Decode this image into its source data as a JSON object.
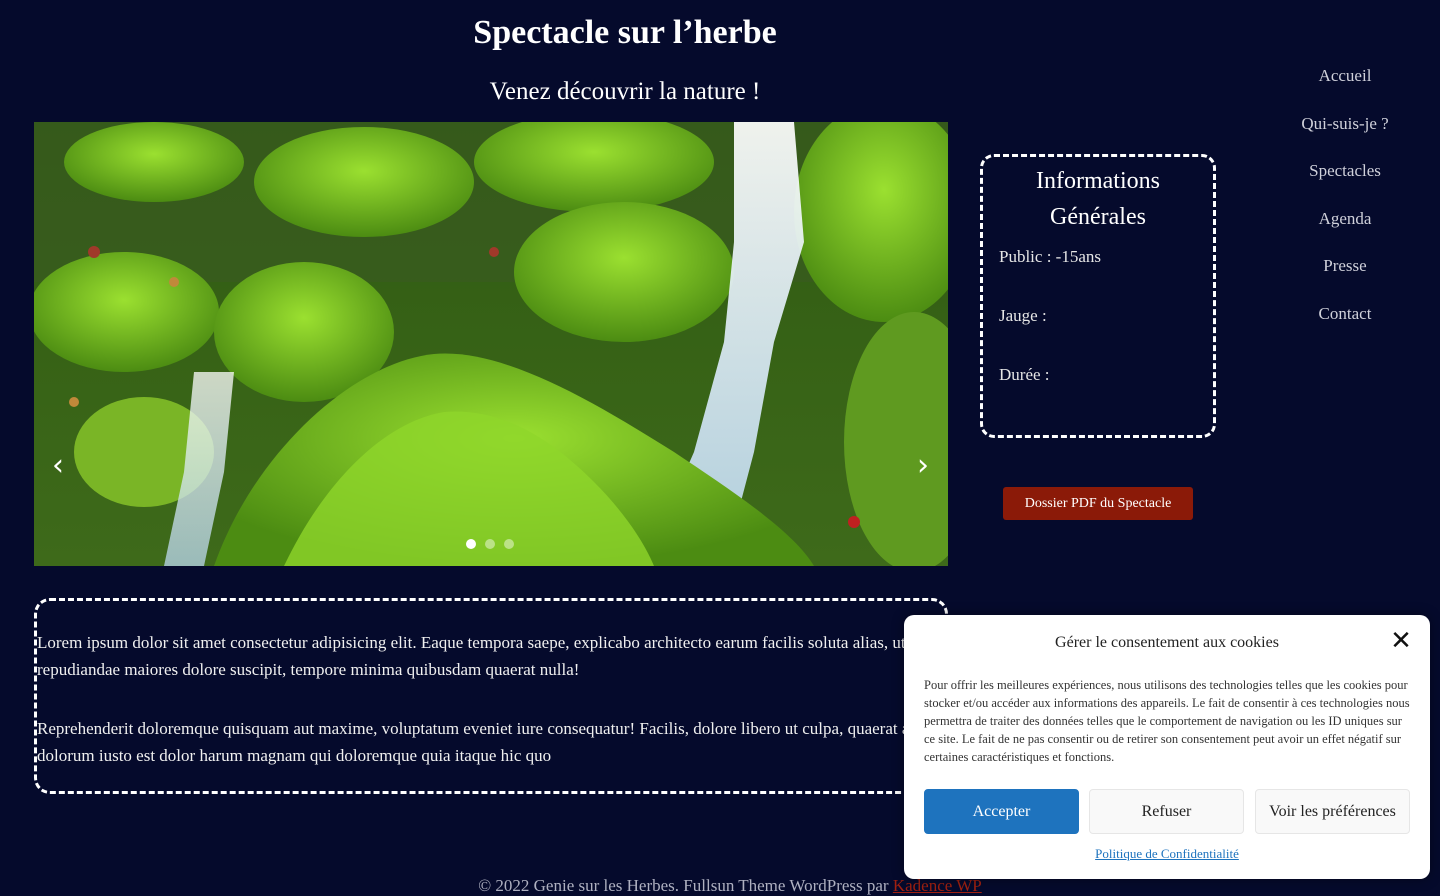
{
  "header": {
    "title": "Spectacle sur l’herbe",
    "subtitle": "Venez découvrir la nature !"
  },
  "nav": {
    "items": [
      "Accueil",
      "Qui-suis-je ?",
      "Spectacles",
      "Agenda",
      "Presse",
      "Contact"
    ]
  },
  "slider": {
    "prev_icon": "chevron-left-icon",
    "next_icon": "chevron-right-icon",
    "prev_glyph": "‹",
    "next_glyph": "›",
    "slide_count": 3,
    "active_slide": 1
  },
  "info": {
    "title": "Informations Générales",
    "public": "Public : -15ans",
    "jauge": "Jauge :",
    "duree": "Durée :"
  },
  "pdf_button": "Dossier PDF du Spectacle",
  "body_text": {
    "p1": "Lorem ipsum dolor sit amet consectetur adipisicing elit. Eaque tempora saepe, explicabo architecto earum facilis soluta alias, ut omnis est repudiandae maiores dolore suscipit, tempore minima quibusdam quaerat nulla!",
    "p2": "Reprehenderit doloremque quisquam aut maxime, voluptatum eveniet iure consequatur! Facilis, dolore libero ut culpa, quaerat asperiores expedita dolorum iusto est dolor harum magnam qui doloremque quia itaque hic quo"
  },
  "footer": {
    "text": "© 2022 Genie sur les Herbes. Fullsun Theme WordPress par ",
    "credit": "Kadence WP"
  },
  "cookie": {
    "title": "Gérer le consentement aux cookies",
    "close_glyph": "✕",
    "close_icon": "close-icon",
    "text": "Pour offrir les meilleures expériences, nous utilisons des technologies telles que les cookies pour stocker et/ou accéder aux informations des appareils. Le fait de consentir à ces technologies nous permettra de traiter des données telles que le comportement de navigation ou les ID uniques sur ce site. Le fait de ne pas consentir ou de retirer son consentement peut avoir un effet négatif sur certaines caractéristiques et fonctions.",
    "accept": "Accepter",
    "refuse": "Refuser",
    "prefs": "Voir les préférences",
    "policy": "Politique de Confidentialité"
  },
  "colors": {
    "background": "#050a2c",
    "pdf_button": "#8b1a08",
    "accept_button": "#1e73be"
  }
}
